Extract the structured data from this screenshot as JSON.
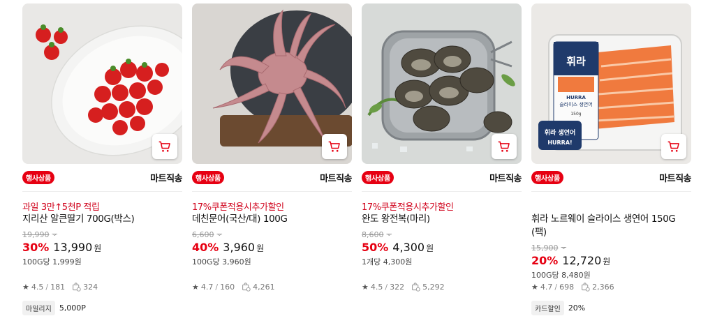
{
  "products": [
    {
      "badge": "행사상품",
      "delivery": "마트직송",
      "promo": "과일 3만↑5천P 적립",
      "name": "지리산 알큰딸기 700G(박스)",
      "original_price": "19,990",
      "discount": "30%",
      "price": "13,990",
      "currency": "원",
      "unit_price": "100G당 1,999원",
      "rating": "4.5",
      "reviews": "181",
      "purchases": "324",
      "extra_label": "마일리지",
      "extra_value": "5,000P",
      "image": "strawberry-photo"
    },
    {
      "badge": "행사상품",
      "delivery": "마트직송",
      "promo": "17%쿠폰적용시추가할인",
      "name": "데친문어(국산/대) 100G",
      "original_price": "6,600",
      "discount": "40%",
      "price": "3,960",
      "currency": "원",
      "unit_price": "100G당 3,960원",
      "rating": "4.7",
      "reviews": "160",
      "purchases": "4,261",
      "extra_label": "",
      "extra_value": "",
      "image": "octopus-photo"
    },
    {
      "badge": "행사상품",
      "delivery": "마트직송",
      "promo": "17%쿠폰적용시추가할인",
      "name": "완도 왕전복(마리)",
      "original_price": "8,600",
      "discount": "50%",
      "price": "4,300",
      "currency": "원",
      "unit_price": "1개당 4,300원",
      "rating": "4.5",
      "reviews": "322",
      "purchases": "5,292",
      "extra_label": "",
      "extra_value": "",
      "image": "abalone-photo"
    },
    {
      "badge": "행사상품",
      "delivery": "마트직송",
      "promo": "",
      "name": "휘라 노르웨이 슬라이스 생연어 150G (팩)",
      "original_price": "15,900",
      "discount": "20%",
      "price": "12,720",
      "currency": "원",
      "unit_price": "100G당 8,480원",
      "rating": "4.7",
      "reviews": "698",
      "purchases": "2,366",
      "extra_label": "카드할인",
      "extra_value": "20%",
      "image": "salmon-photo",
      "package_text": {
        "brand": "휘라",
        "brand_en": "HURRA",
        "product": "슬라이스 생연어",
        "weight": "150g",
        "sticker": "휘라 생연어",
        "sticker_en": "HURRA!"
      }
    }
  ],
  "colors": {
    "accent": "#e60012",
    "promo": "#d0021b"
  }
}
